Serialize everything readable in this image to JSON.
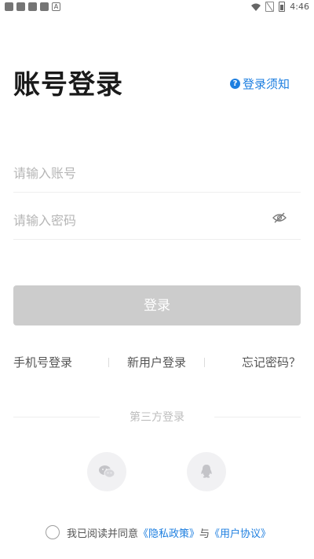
{
  "status_bar": {
    "time": "4:46",
    "letter_icon": "A"
  },
  "header": {
    "title": "账号登录",
    "notice_icon": "?",
    "notice_label": "登录须知"
  },
  "form": {
    "account_placeholder": "请输入账号",
    "password_placeholder": "请输入密码",
    "login_label": "登录"
  },
  "links": {
    "phone_login": "手机号登录",
    "new_user_login": "新用户登录",
    "forgot_password": "忘记密码？"
  },
  "third_party": {
    "label": "第三方登录",
    "providers": [
      "wechat-icon",
      "qq-icon"
    ]
  },
  "agreement": {
    "prefix": "我已阅读并同意",
    "privacy": "《隐私政策》",
    "conjunction": "与",
    "user_agreement": "《用户协议》"
  },
  "colors": {
    "accent": "#1e7fe0",
    "button_disabled": "#cccccc"
  }
}
